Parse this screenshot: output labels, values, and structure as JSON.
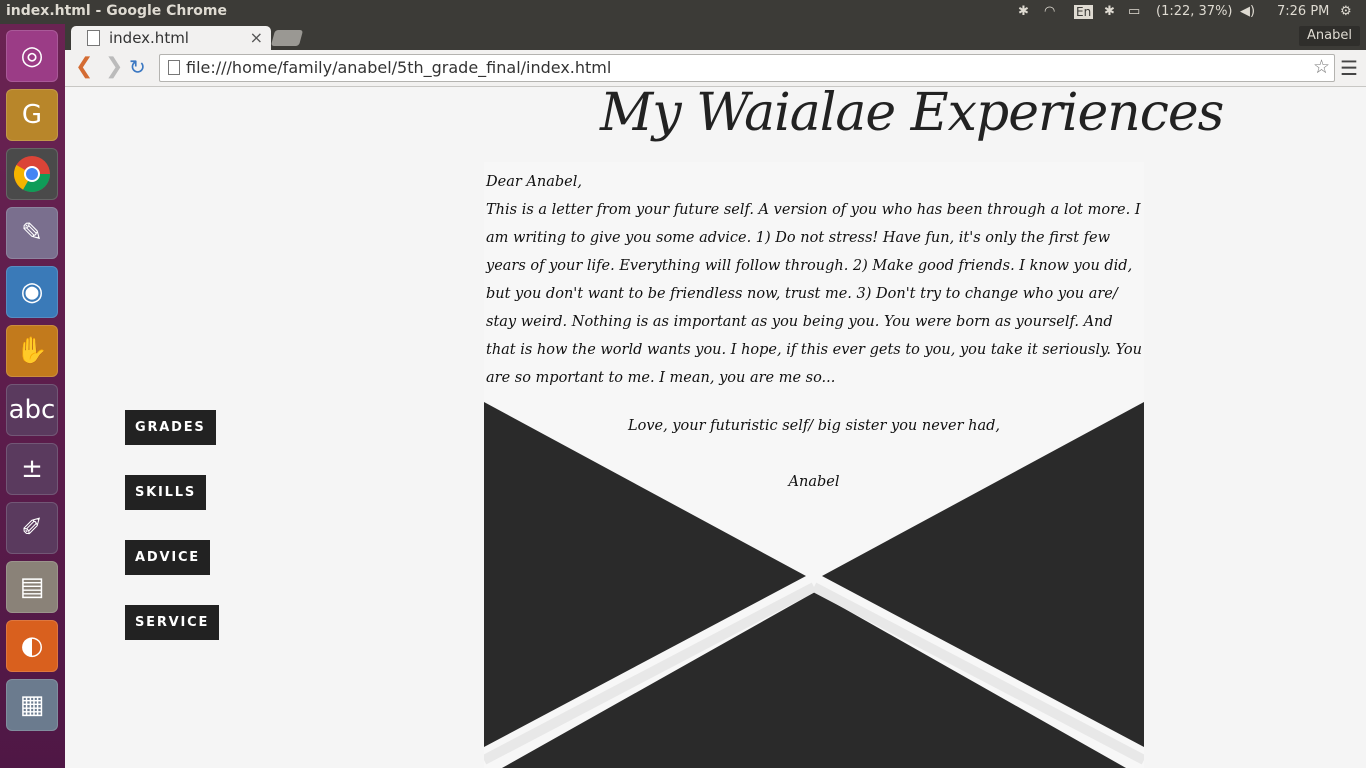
{
  "os": {
    "window_title": "index.html - Google Chrome",
    "indicators": {
      "keyboard": "En",
      "battery": "(1:22, 37%)",
      "clock": "7:26 PM"
    },
    "launcher_icons": [
      "ubuntu-dash-icon",
      "gcompris-icon",
      "chrome-icon",
      "text-editor-icon",
      "world-globe-icon",
      "hand-app-icon",
      "tux-typing-icon",
      "tux-math-icon",
      "tux-paint-icon",
      "file-cabinet-icon",
      "firefox-icon",
      "office-stack-icon"
    ]
  },
  "browser": {
    "tab_title": "index.html",
    "tab_close": "×",
    "profile": "Anabel",
    "url": "file:///home/family/anabel/5th_grade_final/index.html"
  },
  "page": {
    "heading": "My Waialae Experiences",
    "nav": [
      "GRADES",
      "SKILLS",
      "ADVICE",
      "SERVICE"
    ],
    "letter": {
      "greeting": "Dear Anabel,",
      "body": "This is a letter from your future self. A version of you who has been through a lot more. I am writing to give you some advice. 1) Do not stress! Have fun, it's only the first few years of your life. Everything will follow through. 2) Make good friends. I know you did, but you don't want to be friendless now, trust me. 3) Don't try to change who you are/ stay weird. Nothing is as important as you being you. You were born as yourself. And that is how the world wants you. I hope, if this ever gets to you, you take it seriously. You are so mportant to me. I mean, you are me so...",
      "closing": "Love, your futuristic self/ big sister you never had,",
      "signature": "Anabel"
    },
    "colors": {
      "dark": "#2a2a2a",
      "paper": "#f7f7f7",
      "background": "#f5f5f5"
    }
  }
}
